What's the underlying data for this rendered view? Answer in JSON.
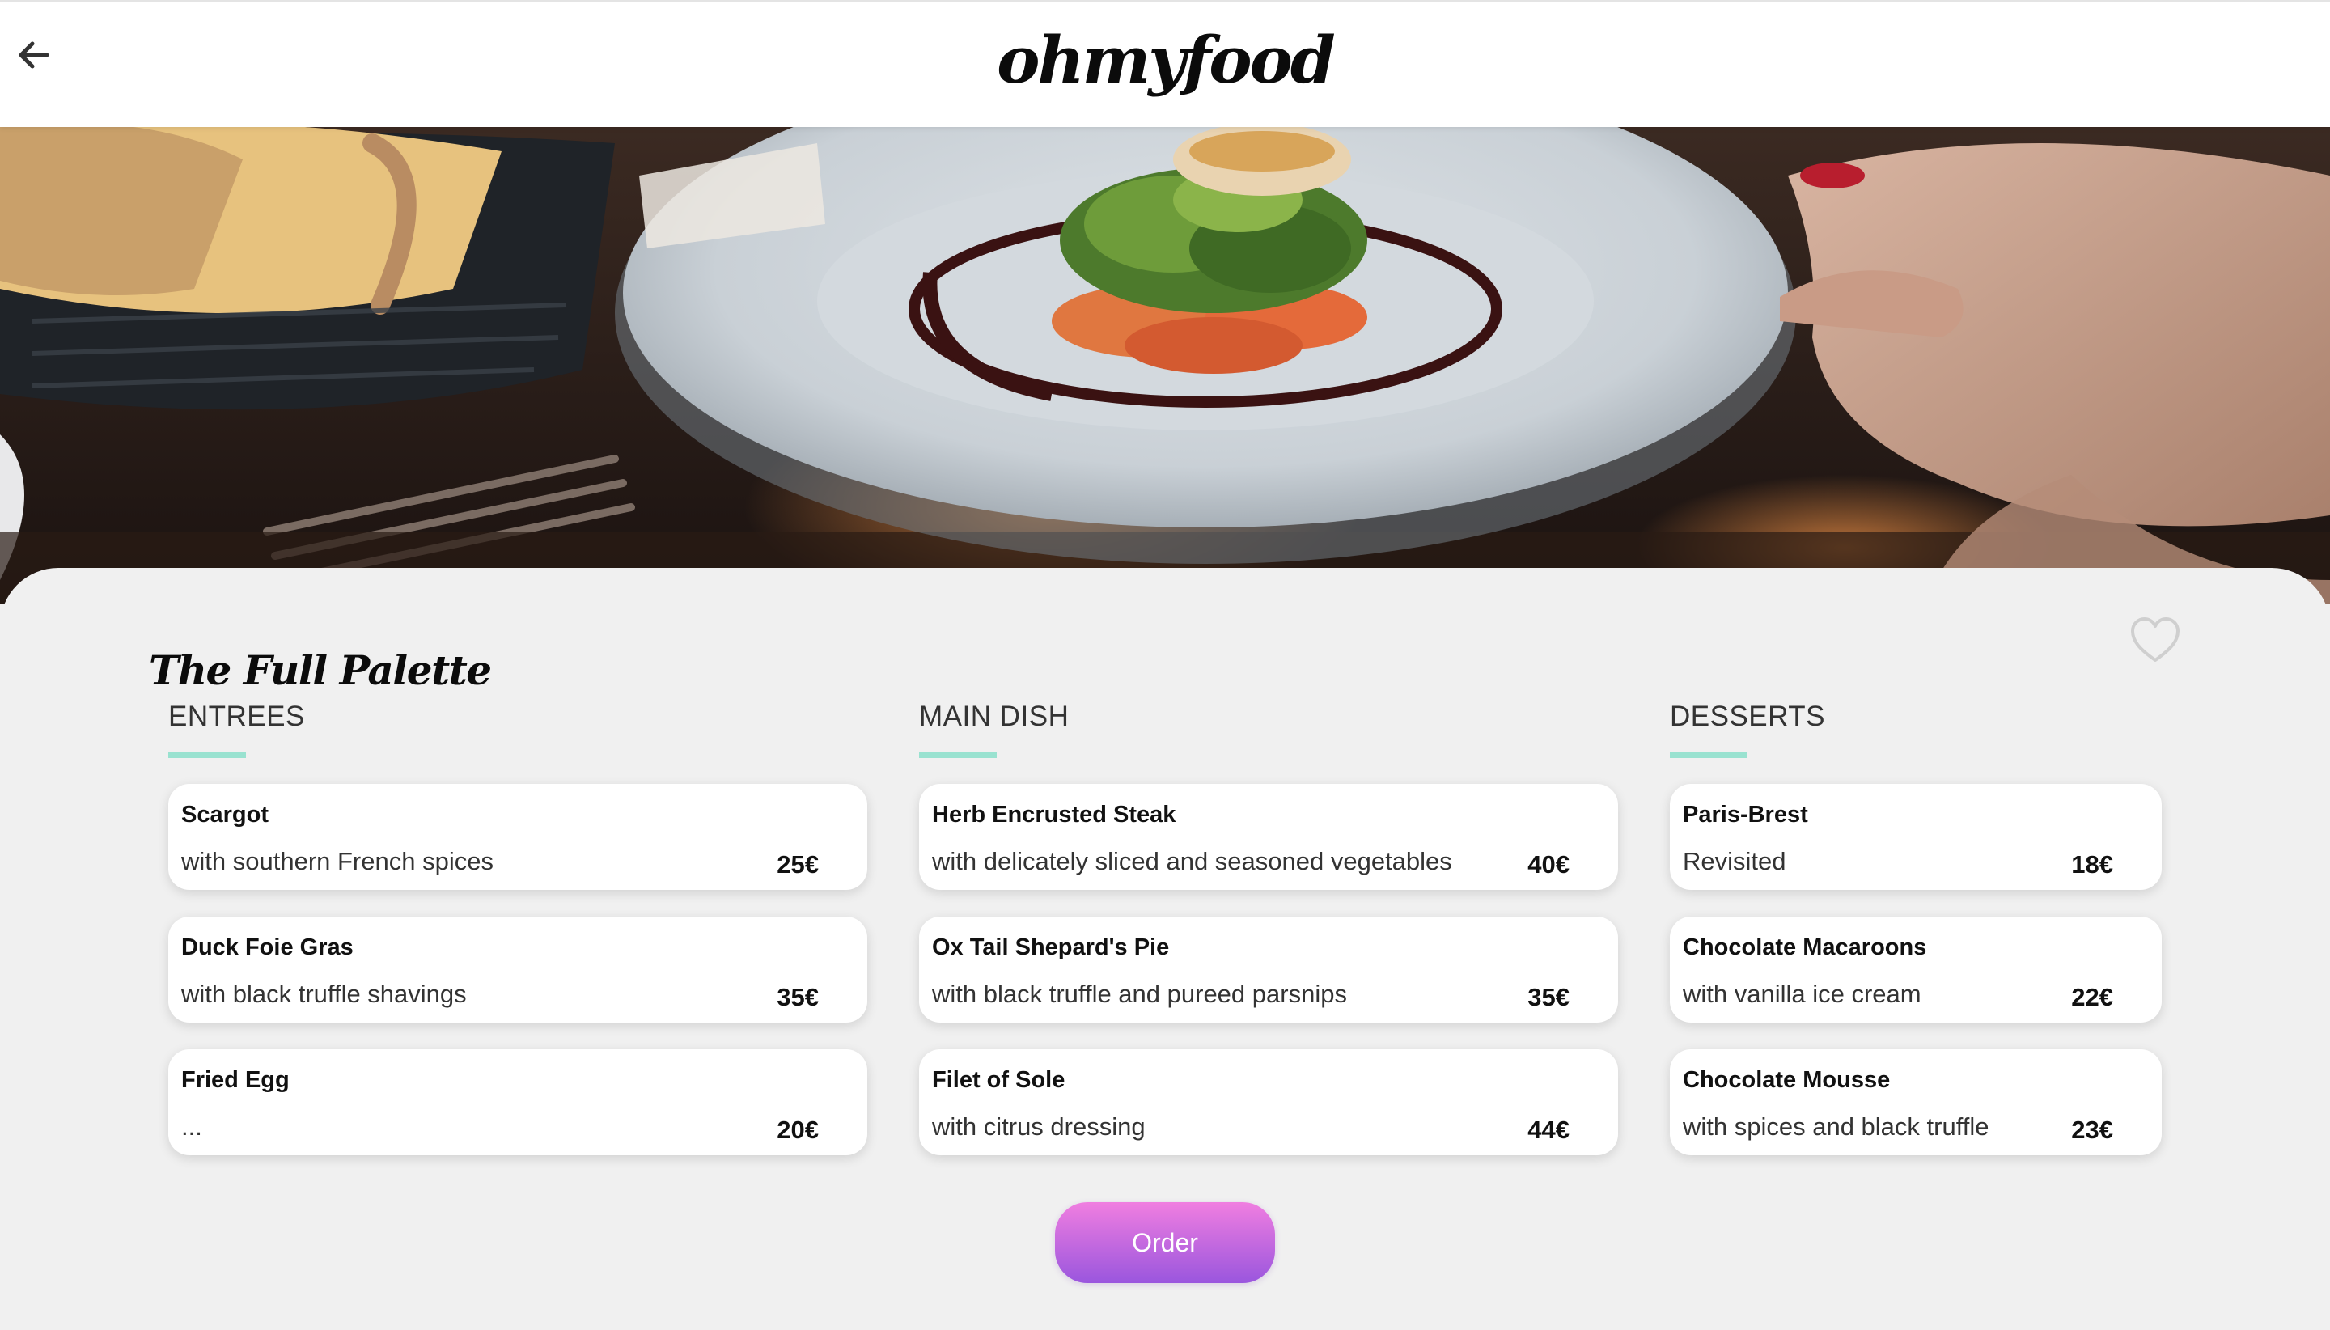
{
  "header": {
    "logo_text": "ohmyfood",
    "back_icon": "arrow-left-icon"
  },
  "hero": {
    "image": "plated-dish-photo"
  },
  "restaurant": {
    "title": "The Full Palette",
    "favorite_icon": "heart-outline-icon"
  },
  "menu": {
    "columns": [
      {
        "heading": "ENTREES",
        "dishes": [
          {
            "name": "Scargot",
            "description": "with southern French spices",
            "price": "25€"
          },
          {
            "name": "Duck Foie Gras",
            "description": "with black truffle shavings",
            "price": "35€"
          },
          {
            "name": "Fried Egg",
            "description": "...",
            "price": "20€"
          }
        ]
      },
      {
        "heading": "MAIN DISH",
        "dishes": [
          {
            "name": "Herb Encrusted Steak",
            "description": "with delicately sliced and seasoned vegetables",
            "price": "40€"
          },
          {
            "name": "Ox Tail Shepard's Pie",
            "description": "with black truffle and pureed parsnips",
            "price": "35€"
          },
          {
            "name": "Filet of Sole",
            "description": "with citrus dressing",
            "price": "44€"
          }
        ]
      },
      {
        "heading": "DESSERTS",
        "dishes": [
          {
            "name": "Paris-Brest",
            "description": "Revisited",
            "price": "18€"
          },
          {
            "name": "Chocolate Macaroons",
            "description": "with vanilla ice cream",
            "price": "22€"
          },
          {
            "name": "Chocolate Mousse",
            "description": "with spices and black truffle",
            "price": "23€"
          }
        ]
      }
    ]
  },
  "order_button": {
    "label": "Order"
  },
  "colors": {
    "accent_underline": "#99e2d0",
    "button_gradient_top": "#f07ee0",
    "button_gradient_bottom": "#9a56de",
    "page_background": "#f0f0f0"
  }
}
